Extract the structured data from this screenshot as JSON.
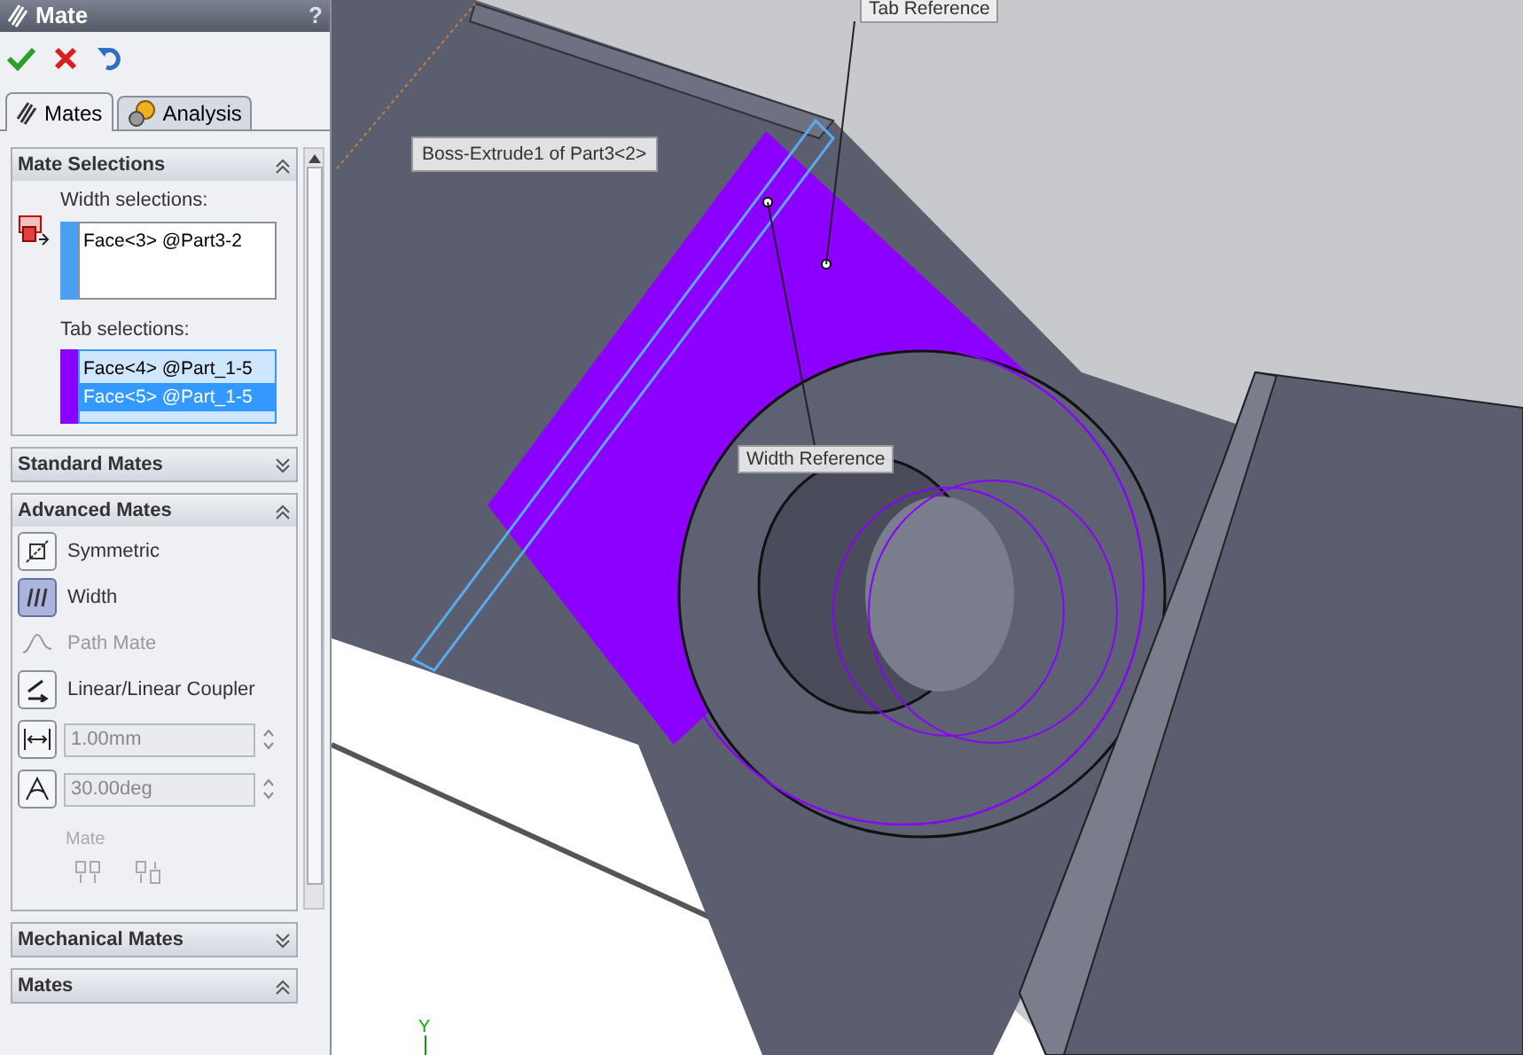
{
  "panel": {
    "title": "Mate",
    "help": "?"
  },
  "tabs": [
    {
      "label": "Mates",
      "selected": true
    },
    {
      "label": "Analysis",
      "selected": false
    }
  ],
  "mate_selections": {
    "title": "Mate Selections",
    "expanded": true,
    "width_label": "Width selections:",
    "width_items": [
      {
        "text": "Face<3> @Part3-2",
        "selected": false
      }
    ],
    "tab_label": "Tab selections:",
    "tab_items": [
      {
        "text": "Face<4> @Part_1-5",
        "selected": false
      },
      {
        "text": "Face<5> @Part_1-5",
        "selected": true
      }
    ]
  },
  "standard_mates": {
    "title": "Standard Mates",
    "expanded": false
  },
  "advanced_mates": {
    "title": "Advanced Mates",
    "expanded": true,
    "options": [
      {
        "label": "Symmetric",
        "kind": "symmetric",
        "selected": false,
        "disabled": false
      },
      {
        "label": "Width",
        "kind": "width",
        "selected": true,
        "disabled": false
      },
      {
        "label": "Path Mate",
        "kind": "path",
        "selected": false,
        "disabled": true
      },
      {
        "label": "Linear/Linear Coupler",
        "kind": "coupler",
        "selected": false,
        "disabled": false
      }
    ],
    "distance": "1.00mm",
    "angle": "30.00deg",
    "mate_label": "Mate"
  },
  "mechanical_mates": {
    "title": "Mechanical Mates",
    "expanded": false
  },
  "mates": {
    "title": "Mates",
    "expanded": true
  },
  "viewport": {
    "callouts": [
      {
        "text": "Tab Reference"
      },
      {
        "text": "Boss-Extrude1 of Part3<2>"
      },
      {
        "text": "Width Reference"
      }
    ],
    "axis_label": "Y"
  }
}
